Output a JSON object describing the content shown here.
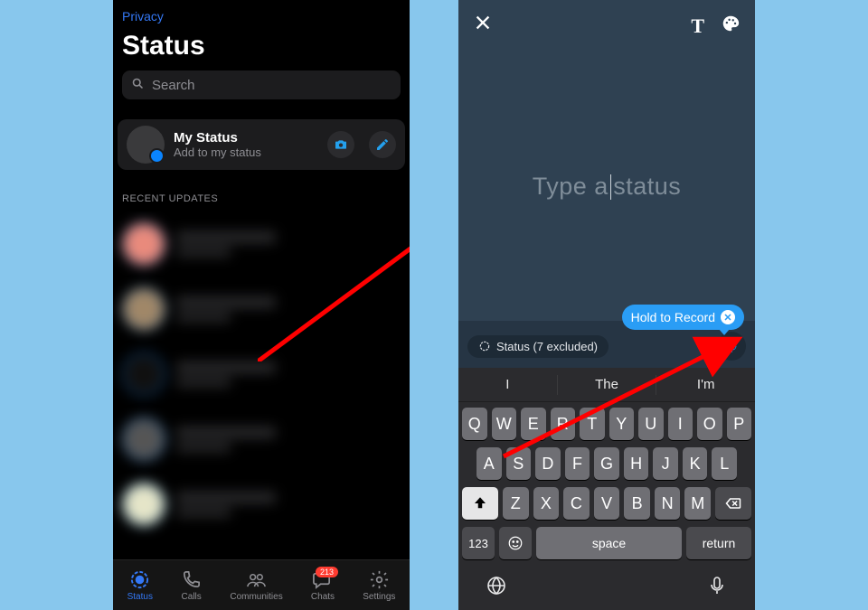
{
  "left": {
    "privacy": "Privacy",
    "title": "Status",
    "search_placeholder": "Search",
    "my_status": {
      "title": "My Status",
      "subtitle": "Add to my status"
    },
    "recent_header": "RECENT UPDATES",
    "tabs": {
      "status": "Status",
      "calls": "Calls",
      "communities": "Communities",
      "chats": "Chats",
      "chats_badge": "213",
      "settings": "Settings"
    }
  },
  "right": {
    "prompt_before": "Type a",
    "prompt_after": "status",
    "tooltip": "Hold to Record",
    "status_chip": "Status (7 excluded)",
    "suggestions": [
      "I",
      "The",
      "I'm"
    ],
    "keyboard": {
      "row1": [
        "Q",
        "W",
        "E",
        "R",
        "T",
        "Y",
        "U",
        "I",
        "O",
        "P"
      ],
      "row2": [
        "A",
        "S",
        "D",
        "F",
        "G",
        "H",
        "J",
        "K",
        "L"
      ],
      "row3": [
        "Z",
        "X",
        "C",
        "V",
        "B",
        "N",
        "M"
      ],
      "k123": "123",
      "space": "space",
      "ret": "return"
    }
  }
}
